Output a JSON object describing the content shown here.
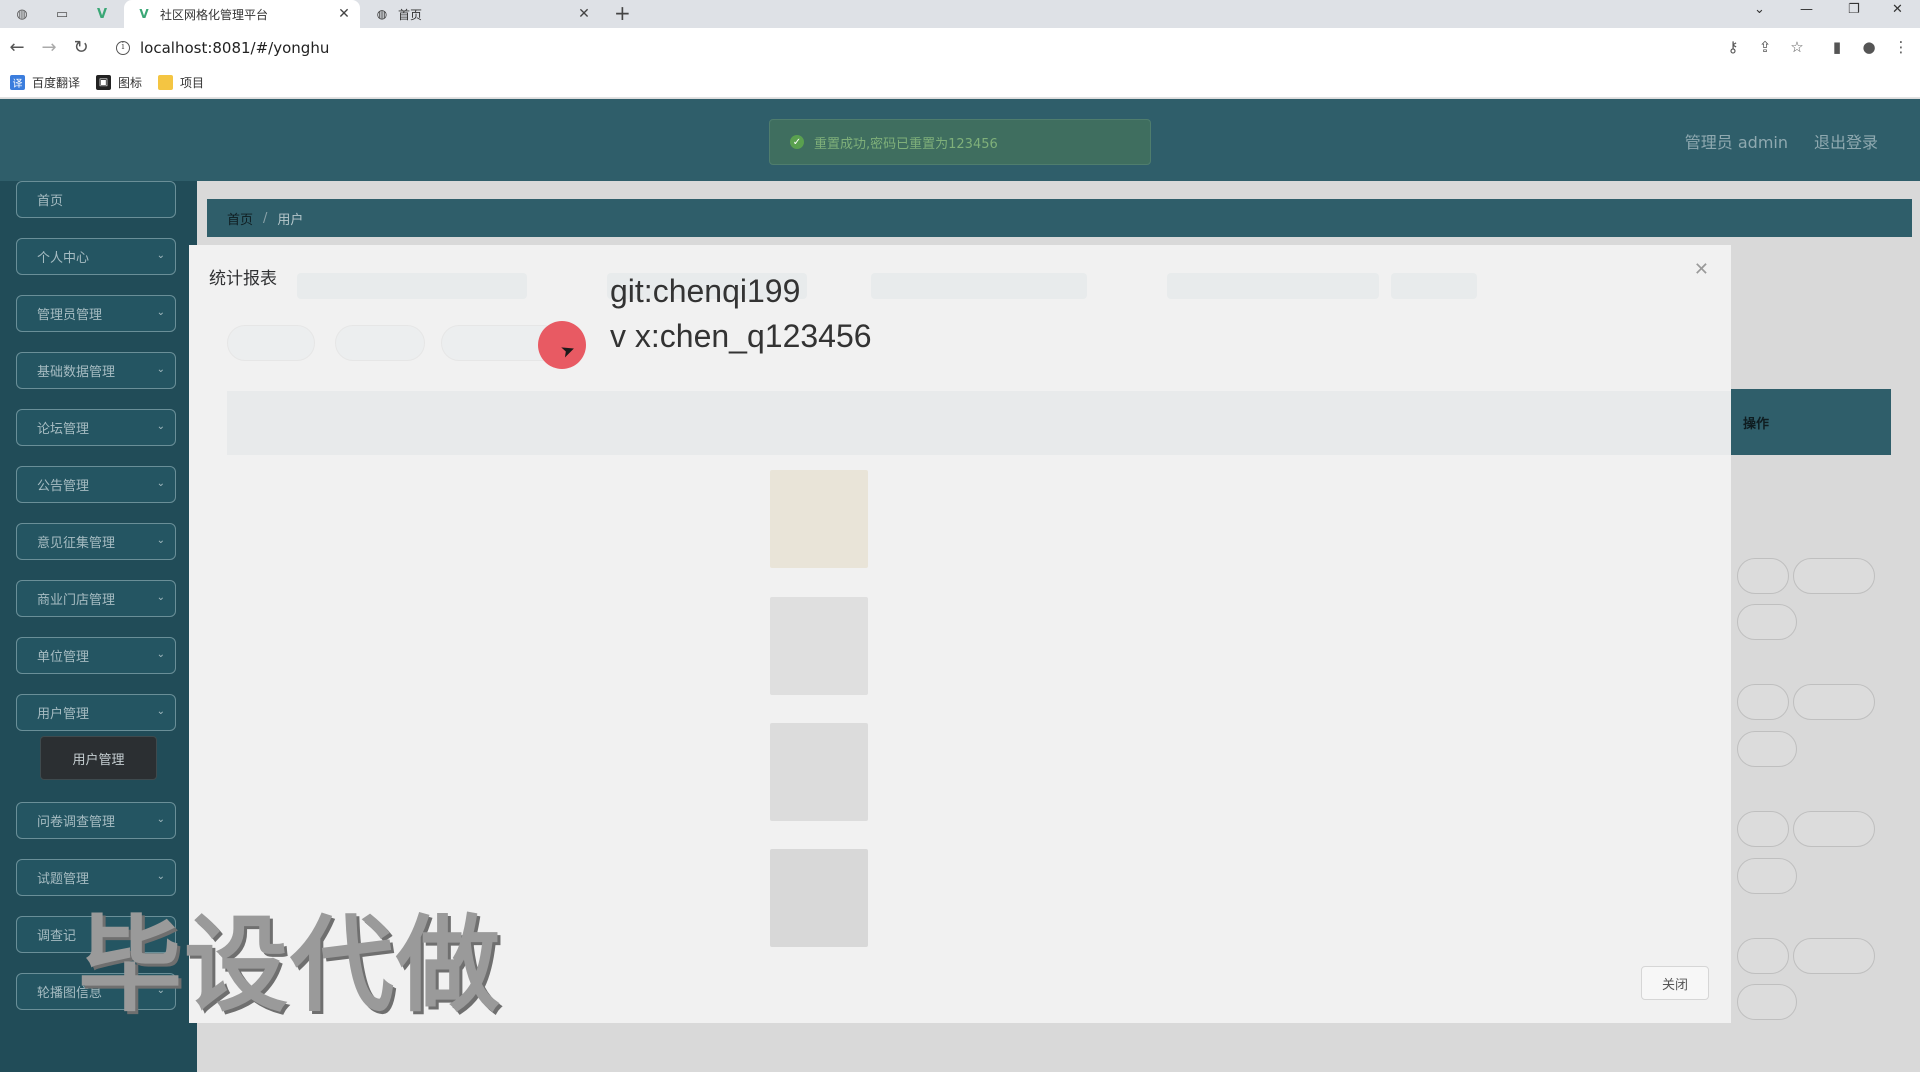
{
  "browser": {
    "tabs": [
      {
        "title": "社区网格化管理平台",
        "active": true
      },
      {
        "title": "首页",
        "active": false
      }
    ],
    "url": "localhost:8081/#/yonghu",
    "bookmarks": [
      "百度翻译",
      "图标",
      "项目"
    ]
  },
  "header": {
    "toast": "重置成功,密码已重置为123456",
    "admin": "管理员 admin",
    "logout": "退出登录"
  },
  "sidebar": {
    "items": [
      "首页",
      "个人中心",
      "管理员管理",
      "基础数据管理",
      "论坛管理",
      "公告管理",
      "意见征集管理",
      "商业门店管理",
      "单位管理",
      "用户管理",
      "问卷调查管理",
      "试题管理",
      "调查记",
      "轮播图信息"
    ],
    "submenu": "用户管理"
  },
  "breadcrumb": {
    "home": "首页",
    "current": "用户"
  },
  "table": {
    "action_header": "操作"
  },
  "modal": {
    "title": "统计报表",
    "close_label": "关闭"
  },
  "overlay": {
    "line1": "git:chenqi199",
    "line2": "v x:chen_q123456"
  },
  "watermark": "毕设代做",
  "colors": {
    "header": "#2f5e6a",
    "sidebar": "#214c58",
    "accent_red": "#e85a63"
  }
}
